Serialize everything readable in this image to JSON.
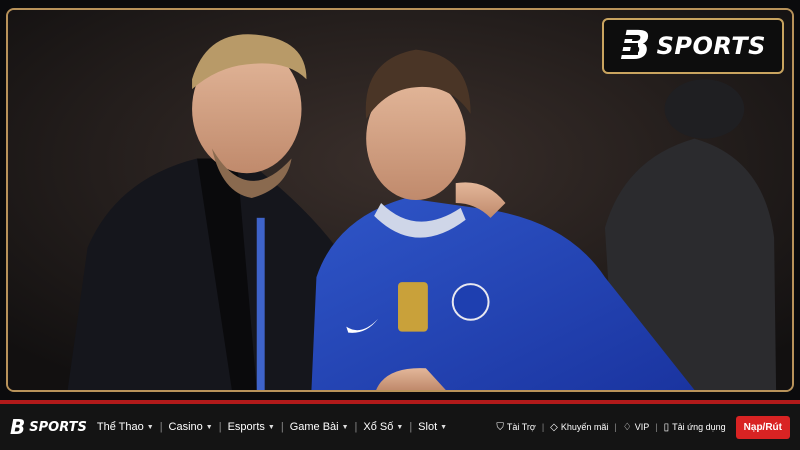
{
  "brand": {
    "logo_mark": "B",
    "logo_text": "SPORTS",
    "accent_gold": "#c9a45f",
    "accent_red": "#d92323"
  },
  "hero": {
    "image_subject": "two football figures, one in a blue kit"
  },
  "nav": {
    "logo_mark": "B",
    "logo_text": "SPORTS",
    "menu": [
      {
        "label": "Thể Thao",
        "has_dropdown": true
      },
      {
        "label": "Casino",
        "has_dropdown": true
      },
      {
        "label": "Esports",
        "has_dropdown": true
      },
      {
        "label": "Game Bài",
        "has_dropdown": true
      },
      {
        "label": "Xổ Số",
        "has_dropdown": true
      },
      {
        "label": "Slot",
        "has_dropdown": true
      }
    ],
    "right_links": [
      {
        "label": "Tài Trợ",
        "icon": "handshake-icon"
      },
      {
        "label": "Khuyến mãi",
        "icon": "tag-icon"
      },
      {
        "label": "VIP",
        "icon": "diamond-icon"
      },
      {
        "label": "Tải ứng dụng",
        "icon": "phone-icon"
      }
    ],
    "cta_label": "Nạp/Rút"
  }
}
